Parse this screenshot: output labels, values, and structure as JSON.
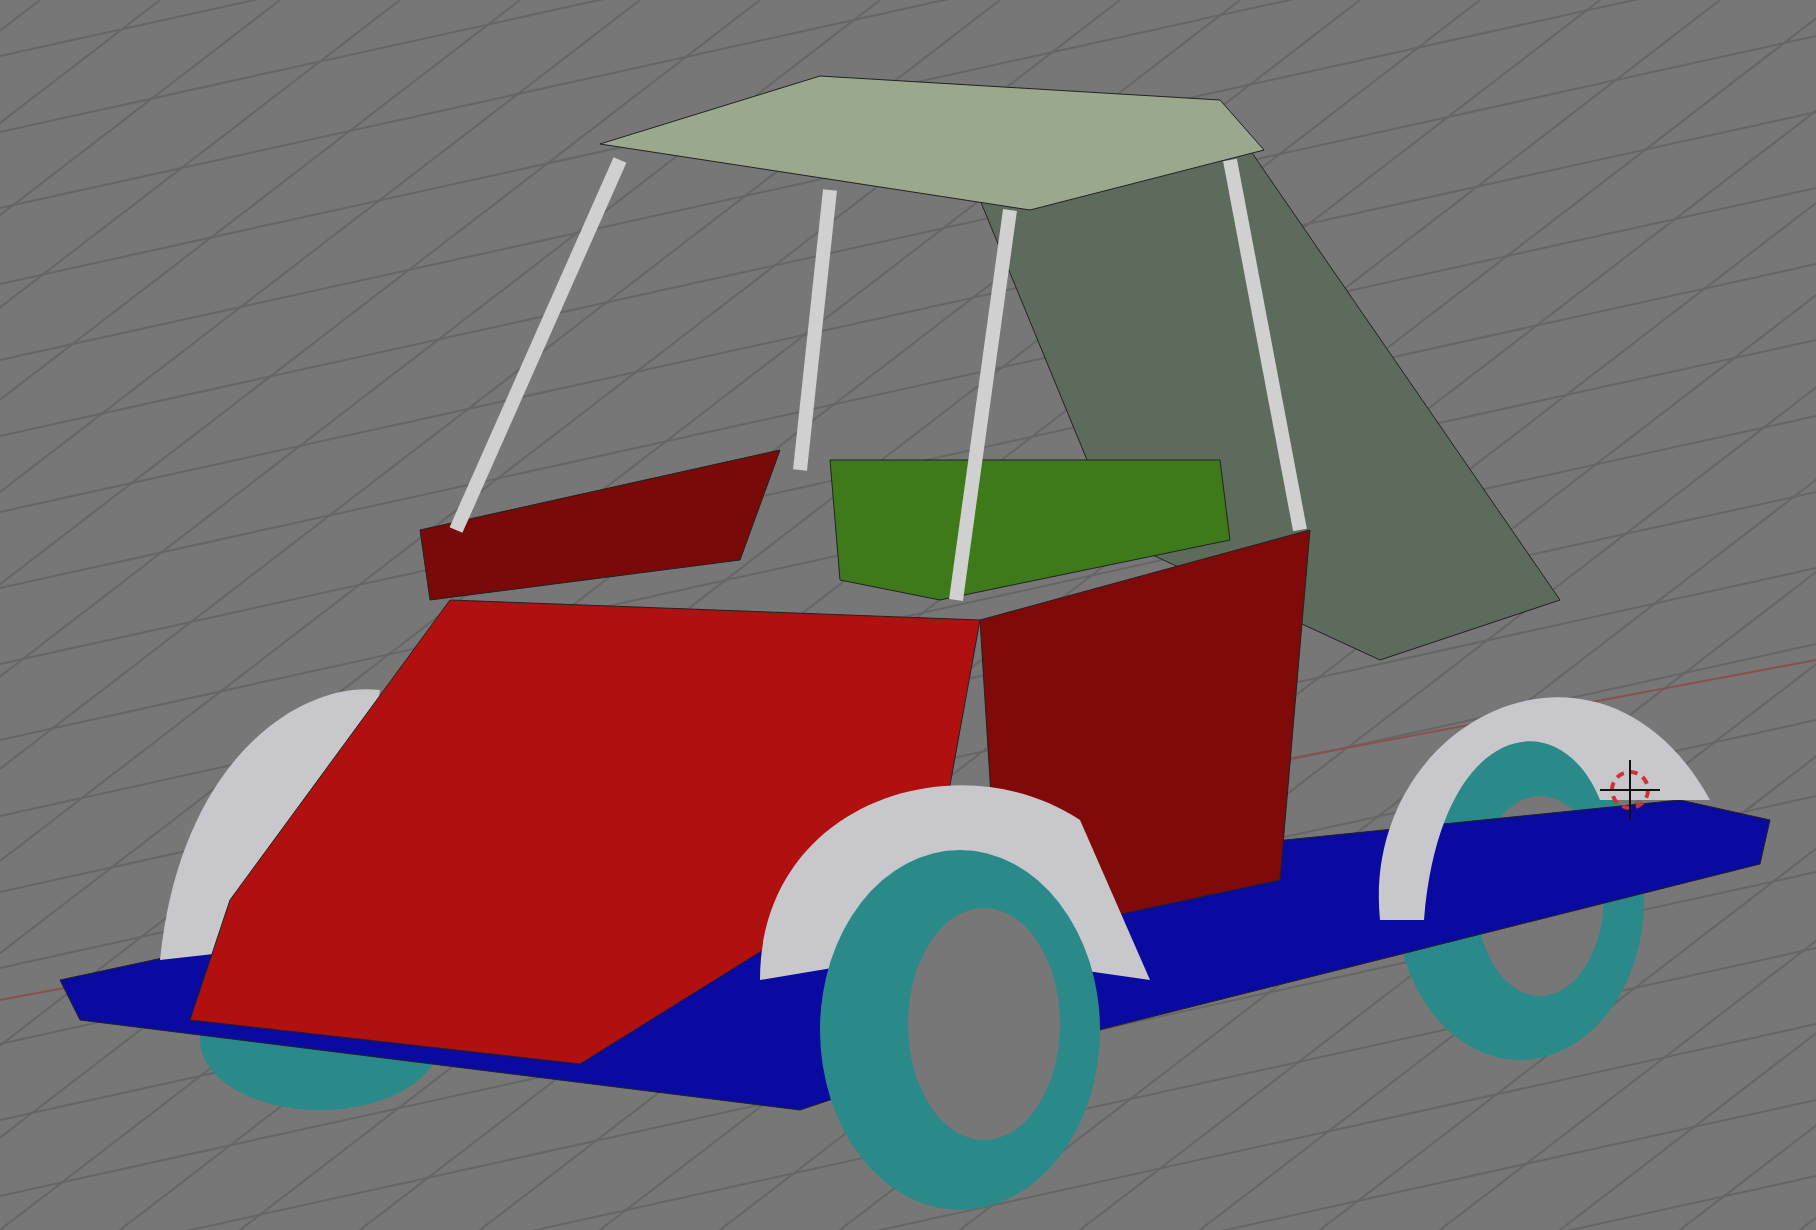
{
  "viewport": {
    "show_grid": true,
    "show_cursor": true
  }
}
